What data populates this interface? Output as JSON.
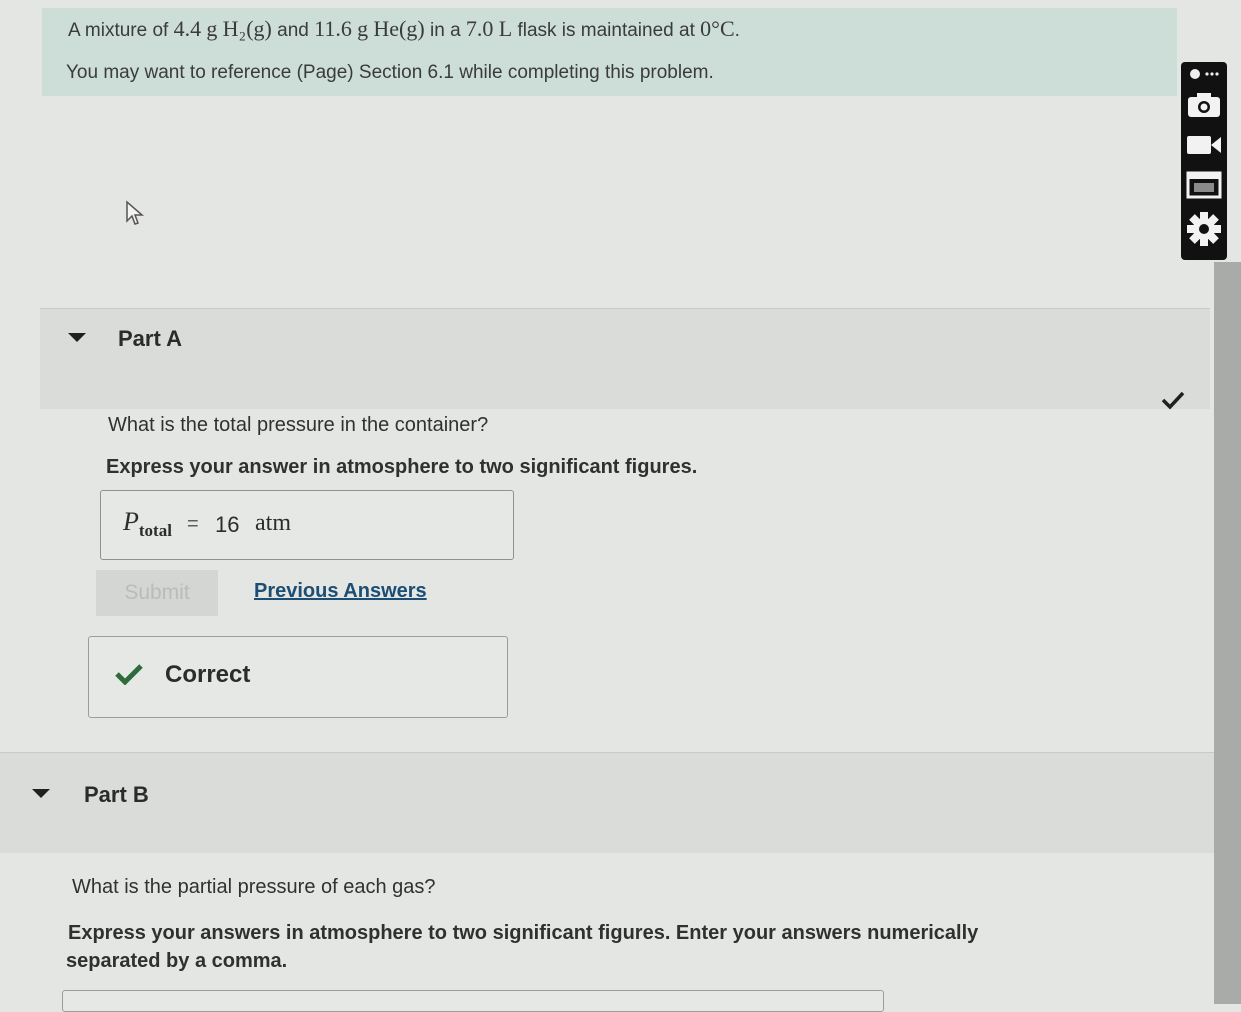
{
  "problem": {
    "intro": "A mixture of",
    "h2_mass": "4.4",
    "h2_unit": "g",
    "h2_formula": "H₂(g)",
    "and": "and",
    "he_mass": "11.6",
    "he_unit": "g",
    "he_formula": "He(g)",
    "in_a": "in a",
    "volume": "7.0",
    "volume_unit": "L",
    "flask_text": "flask is maintained at",
    "temperature": "0",
    "temperature_unit": "°C",
    "period": ".",
    "reference": "You may want to reference (Page) Section 6.1 while completing this problem."
  },
  "part_a": {
    "title": "Part A",
    "question": "What is the total pressure in the container?",
    "instruction": "Express your answer in atmosphere to two significant figures.",
    "answer_symbol": "P",
    "answer_subscript": "total",
    "answer_equals": "=",
    "answer_value": "16",
    "answer_unit": "atm",
    "submit_label": "Submit",
    "previous_answers_label": "Previous Answers",
    "feedback": "Correct"
  },
  "part_b": {
    "title": "Part B",
    "question": "What is the partial pressure of each gas?",
    "instruction_line1": "Express your answers in atmosphere to two significant figures. Enter your answers numerically",
    "instruction_line2": "separated by a comma."
  },
  "icons": {
    "caret": "caret-down-icon",
    "check": "checkmark-icon",
    "toolbar": [
      "link-icon",
      "camera-icon",
      "video-icon",
      "window-icon",
      "gear-icon"
    ]
  },
  "colors": {
    "banner": "#cdddd8",
    "correct_green": "#2e6b3a",
    "link": "#1c4e74"
  }
}
